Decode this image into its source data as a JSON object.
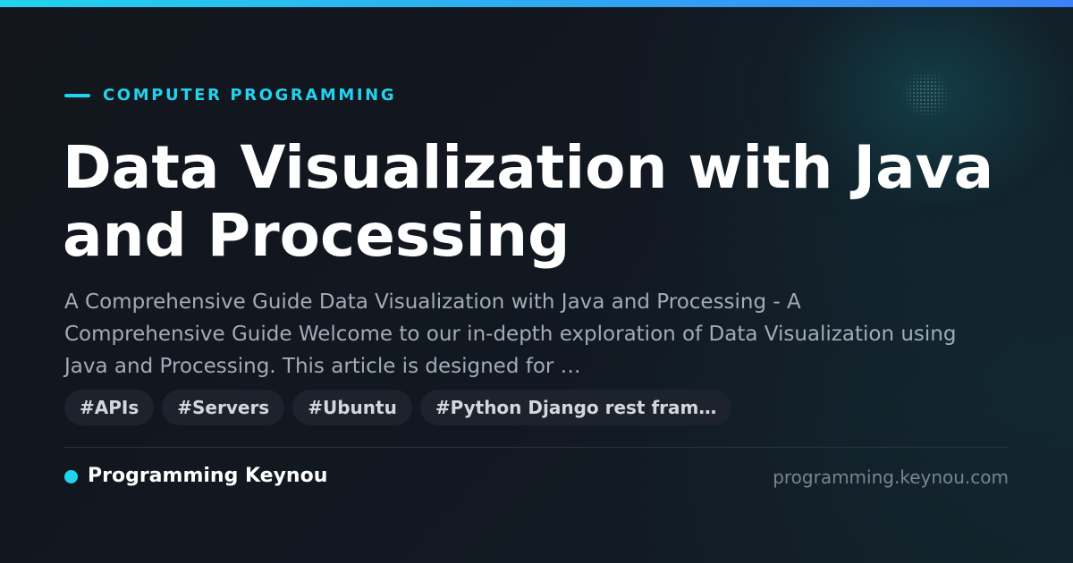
{
  "colors": {
    "accent": "#22d3ee",
    "accent_gradient_end": "#3b82f6",
    "background": "#12161d",
    "title": "#ffffff",
    "description": "#a3abb8",
    "tag_background": "#1d232d",
    "tag_text": "#d4d8de",
    "domain_text": "#7b8491"
  },
  "category": "COMPUTER PROGRAMMING",
  "title": "Data Visualization with Java and Processing",
  "description": "A Comprehensive Guide Data Visualization with Java and Processing - A Comprehensive Guide Welcome to our in-depth exploration of Data Visualization using Java and Processing. This article is designed for …",
  "tags": [
    "#APIs",
    "#Servers",
    "#Ubuntu",
    "#Python Django rest fram…"
  ],
  "footer": {
    "brand": "Programming Keynou",
    "domain": "programming.keynou.com"
  }
}
